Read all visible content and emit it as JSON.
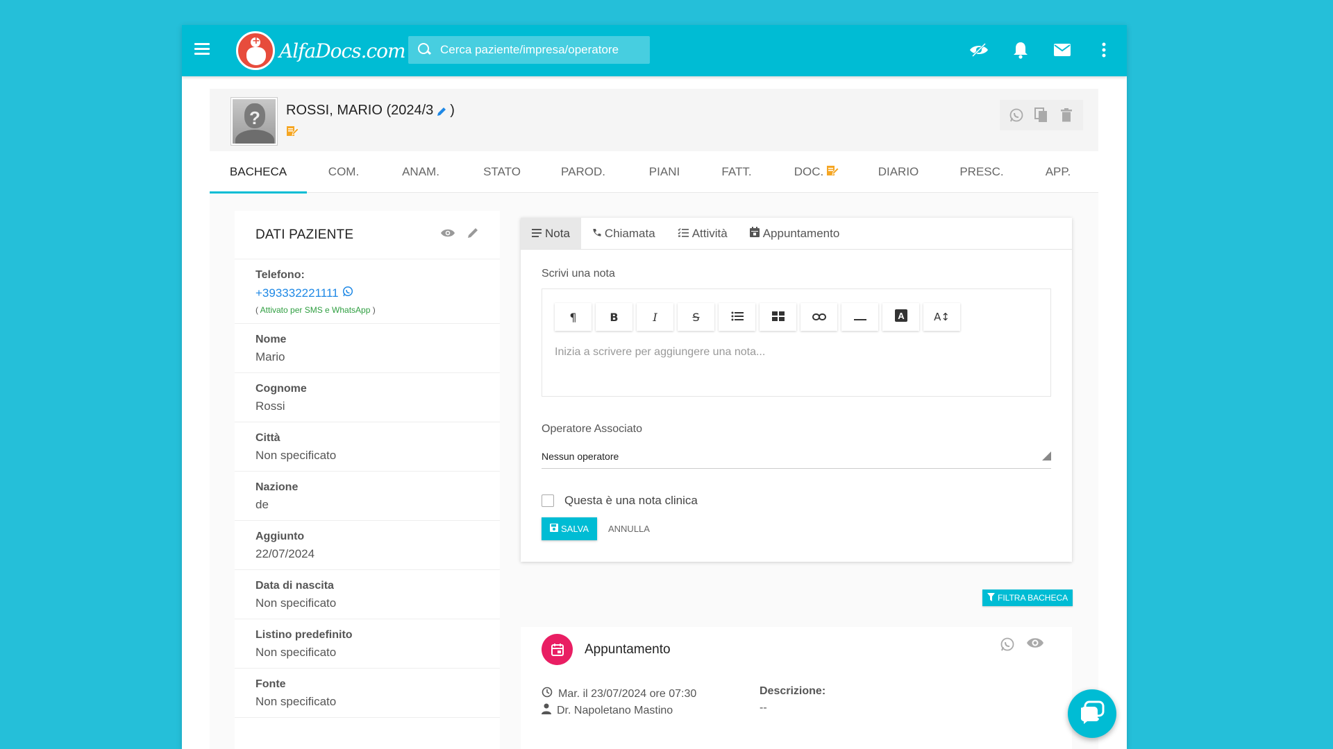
{
  "header": {
    "logo_text": "AlfaDocs.com",
    "search_placeholder": "Cerca paziente/impresa/operatore"
  },
  "patient": {
    "name": "ROSSI, MARIO (2024/3",
    "name_close": ")"
  },
  "tabs": [
    {
      "label": "BACHECA",
      "active": true
    },
    {
      "label": "COM."
    },
    {
      "label": "ANAM."
    },
    {
      "label": "STATO"
    },
    {
      "label": "PAROD."
    },
    {
      "label": "PIANI"
    },
    {
      "label": "FATT."
    },
    {
      "label": "DOC."
    },
    {
      "label": "DIARIO"
    },
    {
      "label": "PRESC."
    },
    {
      "label": "APP."
    }
  ],
  "info": {
    "title": "DATI PAZIENTE",
    "phone_label": "Telefono:",
    "phone_value": "+393332221111",
    "phone_note_open": "( ",
    "phone_note": "Attivato per SMS e WhatsApp",
    "phone_note_close": " )",
    "fields": [
      {
        "label": "Nome",
        "value": "Mario"
      },
      {
        "label": "Cognome",
        "value": "Rossi"
      },
      {
        "label": "Città",
        "value": "Non specificato"
      },
      {
        "label": "Nazione",
        "value": "de"
      },
      {
        "label": "Aggiunto",
        "value": "22/07/2024"
      },
      {
        "label": "Data di nascita",
        "value": "Non specificato"
      },
      {
        "label": "Listino predefinito",
        "value": "Non specificato"
      },
      {
        "label": "Fonte",
        "value": "Non specificato"
      }
    ]
  },
  "note": {
    "tabs": [
      "Nota",
      "Chiamata",
      "Attività",
      "Appuntamento"
    ],
    "label": "Scrivi una nota",
    "placeholder": "Inizia a scrivere per aggiungere una nota...",
    "toolbar": [
      "¶",
      "B",
      "I",
      "S",
      "list",
      "table",
      "link",
      "hr",
      "A",
      "A↕"
    ],
    "operator_label": "Operatore Associato",
    "operator_value": "Nessun operatore",
    "clinical_label": "Questa è una nota clinica",
    "save_label": "SALVA",
    "cancel_label": "ANNULLA"
  },
  "filter_label": "FILTRA BACHECA",
  "appointment": {
    "title": "Appuntamento",
    "date": "Mar. il 23/07/2024 ore 07:30",
    "doctor": "Dr. Napoletano Mastino",
    "desc_label": "Descrizione:",
    "desc_value": "--"
  },
  "colors": {
    "primary": "#00bcd4",
    "background": "#25bfd9",
    "accent_pink": "#e91e63",
    "link_blue": "#1e88e5",
    "note_green": "#2e9e40",
    "doc_orange": "#f5a623"
  }
}
